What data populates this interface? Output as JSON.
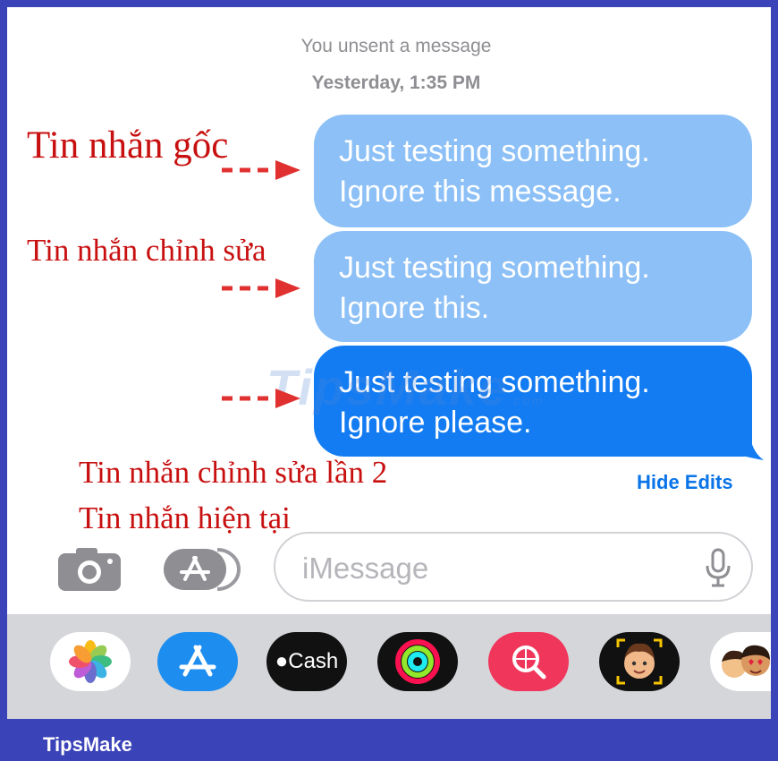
{
  "status": {
    "unsent": "You unsent a message",
    "timestamp": "Yesterday, 1:35 PM"
  },
  "messages": [
    {
      "line1": "Just testing something.",
      "line2": "Ignore this message.",
      "style": "light"
    },
    {
      "line1": "Just testing something.",
      "line2": "Ignore this.",
      "style": "light"
    },
    {
      "line1": "Just testing something.",
      "line2": "Ignore please.",
      "style": "current"
    }
  ],
  "annotations": {
    "original": "Tin nhắn gốc",
    "edited": "Tin nhắn chỉnh sửa",
    "edited_second": "Tin nhắn chỉnh sửa lần 2",
    "current": "Tin nhắn hiện tại"
  },
  "hide_edits_label": "Hide Edits",
  "watermark": {
    "text": "TipsMake",
    "suffix": ".com"
  },
  "composer": {
    "placeholder": "iMessage"
  },
  "app_tray": {
    "apps": [
      {
        "name": "photos-app-icon"
      },
      {
        "name": "app-store-icon"
      },
      {
        "name": "apple-cash-icon",
        "label": "Cash"
      },
      {
        "name": "activity-icon"
      },
      {
        "name": "image-search-icon"
      },
      {
        "name": "memoji-icon"
      },
      {
        "name": "memoji-stickers-icon"
      }
    ]
  },
  "footer": {
    "brand": "TipsMake"
  },
  "colors": {
    "frame": "#3b43b9",
    "bubble_edited": "#8cc0f6",
    "bubble_current": "#137cf3",
    "annotation": "#c81010",
    "link": "#0a74e8"
  }
}
